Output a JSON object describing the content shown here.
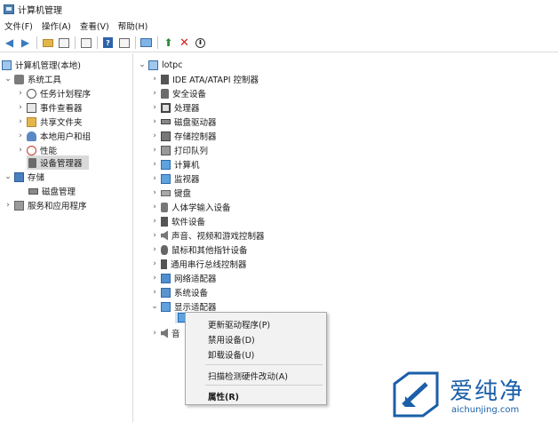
{
  "window": {
    "title": "计算机管理"
  },
  "menu": [
    "文件(F)",
    "操作(A)",
    "查看(V)",
    "帮助(H)"
  ],
  "tree": {
    "root": "计算机管理(本地)",
    "system_tools": "系统工具",
    "task_scheduler": "任务计划程序",
    "event_viewer": "事件查看器",
    "shared_folders": "共享文件夹",
    "local_users": "本地用户和组",
    "performance": "性能",
    "device_manager": "设备管理器",
    "storage": "存储",
    "disk_management": "磁盘管理",
    "services": "服务和应用程序"
  },
  "devices": {
    "computer_name": "lotpc",
    "categories": [
      "IDE ATA/ATAPI 控制器",
      "安全设备",
      "处理器",
      "磁盘驱动器",
      "存储控制器",
      "打印队列",
      "计算机",
      "监视器",
      "键盘",
      "人体学输入设备",
      "软件设备",
      "声音、视频和游戏控制器",
      "鼠标和其他指针设备",
      "通用串行总线控制器",
      "网络适配器",
      "系统设备",
      "显示适配器"
    ],
    "partial_next": "音"
  },
  "context_menu": {
    "update_driver": "更新驱动程序(P)",
    "disable_device": "禁用设备(D)",
    "uninstall_device": "卸载设备(U)",
    "scan_hardware": "扫描检测硬件改动(A)",
    "properties": "属性(R)"
  },
  "watermark": {
    "brand": "爱纯净",
    "url": "aichunjing.com"
  }
}
